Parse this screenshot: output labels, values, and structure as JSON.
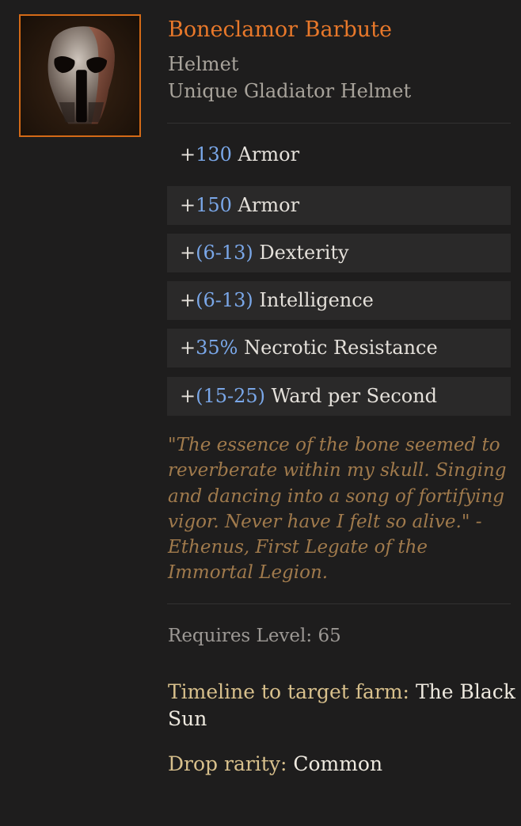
{
  "item": {
    "icon": "skull-helmet-icon",
    "name": "Boneclamor Barbute",
    "type": "Helmet",
    "subtype": "Unique Gladiator Helmet"
  },
  "affixes": [
    {
      "prefix": "+",
      "value": "130",
      "stat": " Armor"
    },
    {
      "prefix": "+",
      "value": "150",
      "stat": " Armor"
    },
    {
      "prefix": "+",
      "value": "(6-13)",
      "stat": " Dexterity"
    },
    {
      "prefix": "+",
      "value": "(6-13)",
      "stat": " Intelligence"
    },
    {
      "prefix": "+",
      "value": "35%",
      "stat": " Necrotic Resistance"
    },
    {
      "prefix": "+",
      "value": "(15-25)",
      "stat": " Ward per Second"
    }
  ],
  "lore": "\"The essence of the bone seemed to reverberate within my skull. Singing and dancing into a song of fortifying vigor. Never have I felt so alive.\" - Ethenus, First Legate of the Immortal Legion.",
  "requirements": {
    "label": "Requires Level: ",
    "level": "65"
  },
  "farm": {
    "label": "Timeline to target farm: ",
    "value": "The Black Sun"
  },
  "drop": {
    "label": "Drop rarity: ",
    "value": "Common"
  },
  "colors": {
    "unique": "#e8782a",
    "affix_number": "#7aa7e8",
    "lore": "#a07a4c",
    "background": "#1e1d1d"
  }
}
